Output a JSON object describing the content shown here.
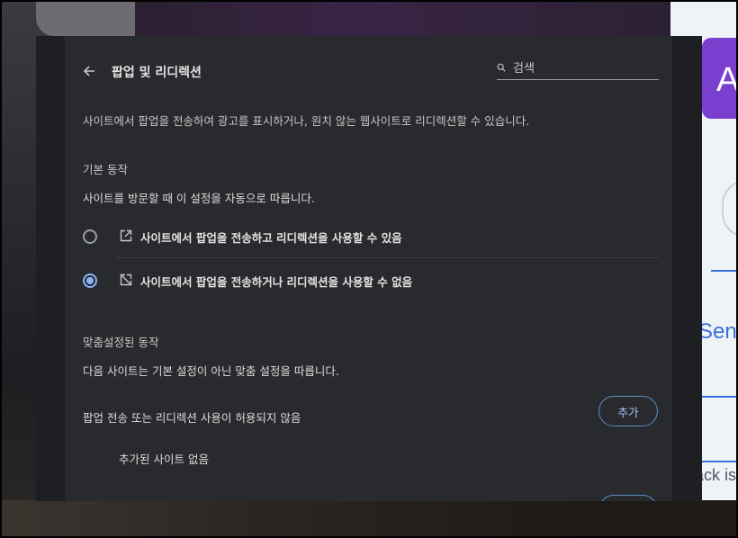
{
  "header": {
    "title": "팝업 및 리디렉션",
    "search_placeholder": "검색"
  },
  "description": "사이트에서 팝업을 전송하여 광고를 표시하거나, 원치 않는 웹사이트로 리디렉션할 수 있습니다.",
  "default_behavior": {
    "title": "기본 동작",
    "subtitle": "사이트를 방문할 때 이 설정을 자동으로 따릅니다.",
    "options": [
      {
        "label": "사이트에서 팝업을 전송하고 리디렉션을 사용할 수 있음",
        "icon": "open-in-new-icon",
        "checked": false
      },
      {
        "label": "사이트에서 팝업을 전송하거나 리디렉션을 사용할 수 없음",
        "icon": "popup-blocked-icon",
        "checked": true
      }
    ]
  },
  "custom_behavior": {
    "title": "맞춤설정된 동작",
    "subtitle": "다음 사이트는 기본 설정이 아닌 맞춤 설정을 따릅니다.",
    "blocked_list": {
      "label": "팝업 전송 또는 리디렉션 사용이 허용되지 않음",
      "add_label": "추가",
      "empty_text": "추가된 사이트 없음"
    }
  },
  "background": {
    "right_letter": "A",
    "right_word": "Sen",
    "right_word2": "ack is"
  },
  "colors": {
    "accent": "#8ab4f8",
    "surface": "#292a2d",
    "text": "#e3e3e3"
  }
}
